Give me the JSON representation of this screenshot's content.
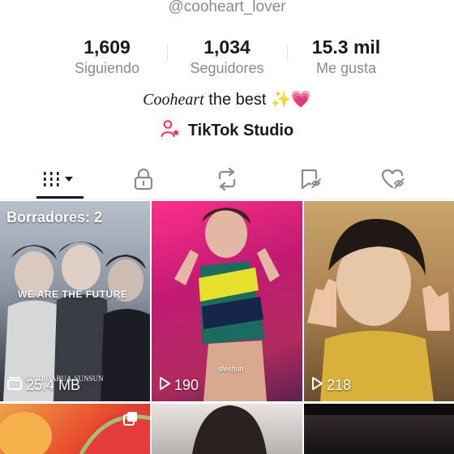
{
  "profile": {
    "username": "@cooheart_lover",
    "stats": [
      {
        "value": "1,609",
        "label": "Siguiendo"
      },
      {
        "value": "1,034",
        "label": "Seguidores"
      },
      {
        "value": "15.3 mil",
        "label": "Me gusta"
      }
    ],
    "bio": {
      "script": "Cooheart",
      "text": "the best",
      "sparkle": "✨",
      "heart": "💗"
    },
    "studio_label": "TikTok Studio"
  },
  "tabs": [
    {
      "icon": "videos-grid-icon",
      "active": true
    },
    {
      "icon": "lock-icon"
    },
    {
      "icon": "repost-icon"
    },
    {
      "icon": "favorites-bookmark-icon"
    },
    {
      "icon": "liked-heart-icon"
    }
  ],
  "videos": [
    {
      "overlay_title": "Borradores: 2",
      "caption_text": "WE ARE THE FUTURE",
      "footer_text": "STUDIOABUA-SUNSUN",
      "meta_icon": "drafts-icon",
      "meta": "25.4 MB"
    },
    {
      "meta_icon": "play-icon",
      "meta": "190",
      "watermark": "sfeshun"
    },
    {
      "meta_icon": "play-icon",
      "meta": "218"
    },
    {
      "pinned_icon": "multi-photo-icon"
    },
    {},
    {}
  ],
  "colors": {
    "accent": "#fe2c55",
    "text": "#161823",
    "muted": "#8a8b91"
  }
}
